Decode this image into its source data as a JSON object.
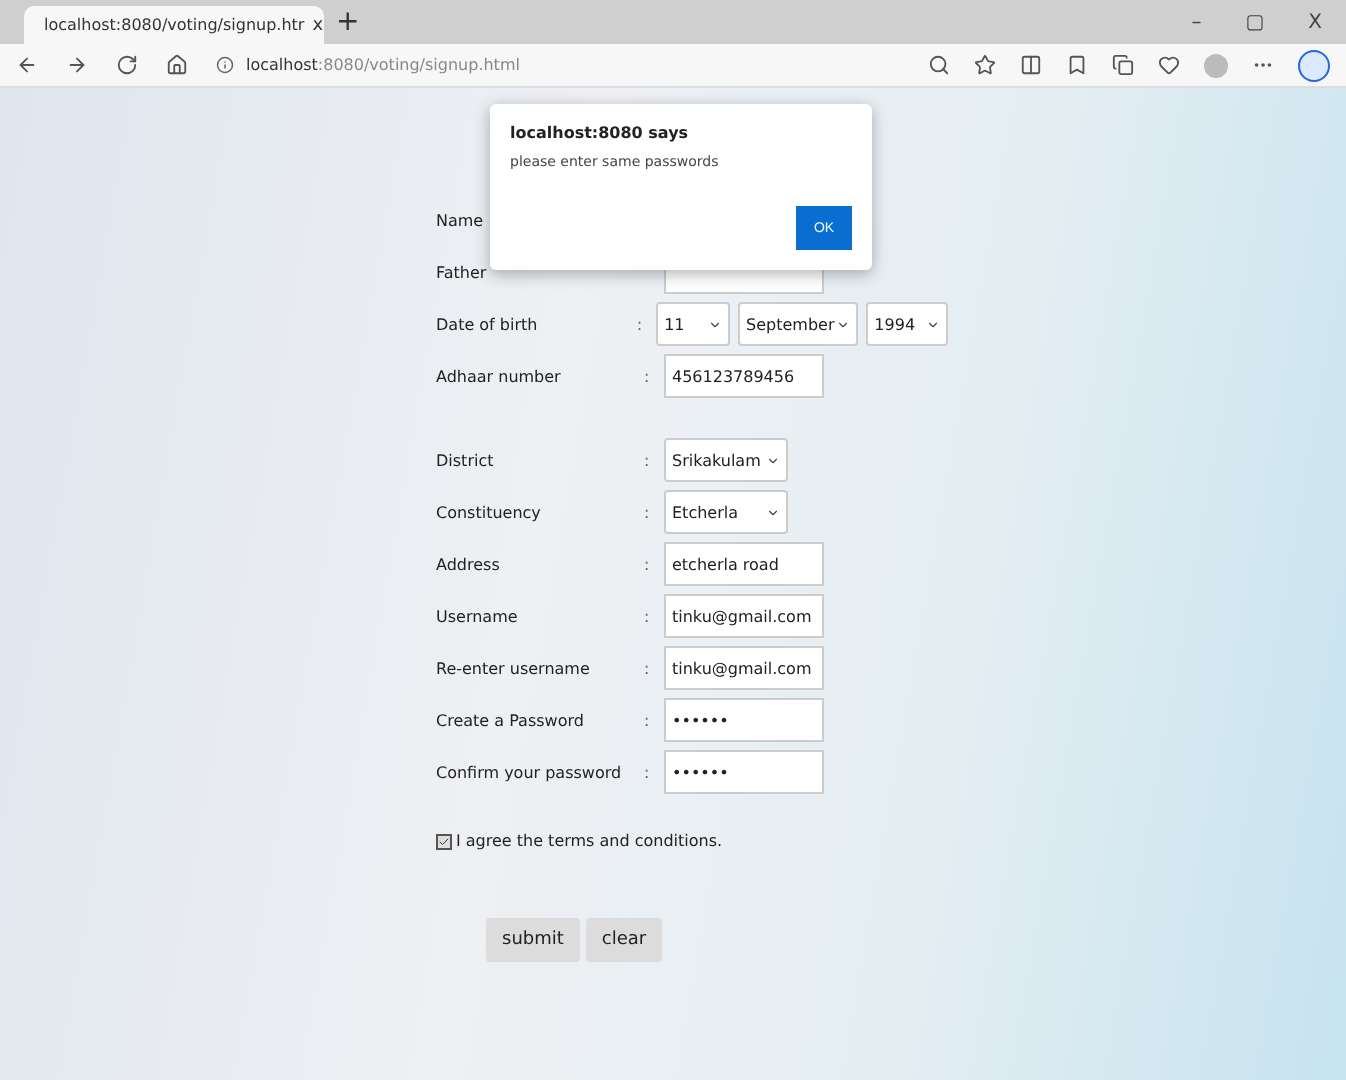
{
  "browser": {
    "tab_title": "localhost:8080/voting/signup.htr",
    "tab_close": "x",
    "new_tab": "+",
    "url_host": "localhost",
    "url_rest": ":8080/voting/signup.html",
    "window_buttons": [
      "–",
      "▢",
      "X"
    ]
  },
  "form": {
    "rows": [
      {
        "kind": "label",
        "label": "Name"
      },
      {
        "kind": "text",
        "label": "Father"
      },
      {
        "kind": "date",
        "label": "Date of birth",
        "separator": ":",
        "parts": [
          "11",
          "September",
          "1994"
        ]
      },
      {
        "kind": "text",
        "label": "Adhaar number",
        "separator": ":",
        "value": "456123789456"
      },
      {
        "kind": "gap"
      },
      {
        "kind": "select",
        "label": "District",
        "separator": ":",
        "value": "Srikakulam"
      },
      {
        "kind": "select",
        "label": "Constituency",
        "separator": ":",
        "value": "Etcherla"
      },
      {
        "kind": "text",
        "label": "Address",
        "separator": ":",
        "value": "etcherla road"
      },
      {
        "kind": "text",
        "label": "Username",
        "separator": ":",
        "value": "tinku@gmail.com"
      },
      {
        "kind": "text",
        "label": "Re-enter username",
        "separator": ":",
        "value": "tinku@gmail.com"
      },
      {
        "kind": "text",
        "label": "Create a Password",
        "separator": ":",
        "value": "••••••"
      },
      {
        "kind": "text",
        "label": "Confirm your password",
        "separator": ":",
        "value": "••••••"
      }
    ],
    "agree": {
      "label": "I agree the terms and conditions.",
      "checked": true
    },
    "buttons": [
      "submit",
      "clear"
    ]
  },
  "dialog": {
    "title": "localhost:8080 says",
    "message": "please enter same passwords",
    "button": "OK"
  }
}
